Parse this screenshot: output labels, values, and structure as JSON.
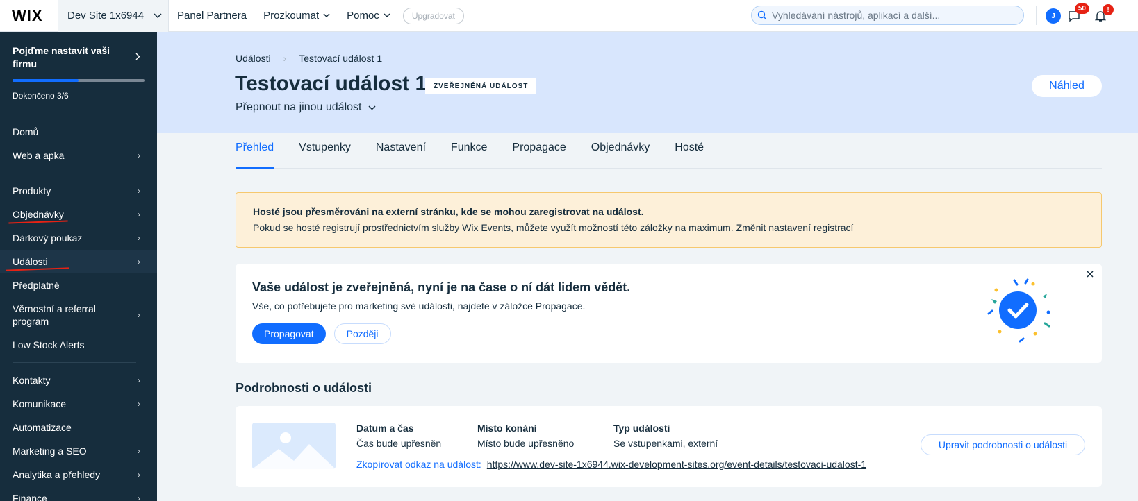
{
  "topbar": {
    "logo": "WIX",
    "site_name": "Dev Site 1x6944",
    "nav": [
      {
        "label": "Panel Partnera",
        "has_dropdown": false
      },
      {
        "label": "Prozkoumat",
        "has_dropdown": true
      },
      {
        "label": "Pomoc",
        "has_dropdown": true
      }
    ],
    "upgrade_label": "Upgradovat",
    "search_placeholder": "Vyhledávání nástrojů, aplikací a další...",
    "avatar_initial": "J",
    "messages_badge": "50",
    "notifications_badge": "!"
  },
  "sidebar": {
    "setup_title": "Pojďme nastavit vaši firmu",
    "setup_progress": 0.5,
    "setup_done": "Dokončeno 3/6",
    "items": [
      {
        "label": "Domů",
        "chevron": false
      },
      {
        "label": "Web a apka",
        "chevron": true
      },
      {
        "label": "Produkty",
        "chevron": true
      },
      {
        "label": "Objednávky",
        "chevron": true
      },
      {
        "label": "Dárkový poukaz",
        "chevron": true
      },
      {
        "label": "Události",
        "chevron": true
      },
      {
        "label": "Předplatné",
        "chevron": false
      },
      {
        "label": "Věrnostní a referral program",
        "chevron": true
      },
      {
        "label": "Low Stock Alerts",
        "chevron": false
      },
      {
        "label": "Kontakty",
        "chevron": true
      },
      {
        "label": "Komunikace",
        "chevron": true
      },
      {
        "label": "Automatizace",
        "chevron": false
      },
      {
        "label": "Marketing a SEO",
        "chevron": true
      },
      {
        "label": "Analytika a přehledy",
        "chevron": true
      },
      {
        "label": "Finance",
        "chevron": true
      }
    ]
  },
  "header": {
    "breadcrumb": [
      "Události",
      "Testovací událost 1"
    ],
    "title": "Testovací událost 1",
    "status_badge": "ZVEŘEJNĚNÁ UDÁLOST",
    "switch_event": "Přepnout na jinou událost",
    "preview_label": "Náhled"
  },
  "tabs": [
    "Přehled",
    "Vstupenky",
    "Nastavení",
    "Funkce",
    "Propagace",
    "Objednávky",
    "Hosté"
  ],
  "notice": {
    "title": "Hosté jsou přesměrováni na externí stránku, kde se mohou zaregistrovat na událost.",
    "text": "Pokud se hosté registrují prostřednictvím služby Wix Events, můžete využít možností této záložky na maximum.",
    "link": "Změnit nastavení registrací"
  },
  "promo": {
    "title": "Vaše událost je zveřejněná, nyní je na čase o ní dát lidem vědět.",
    "text": "Vše, co potřebujete pro marketing své události, najdete v záložce Propagace.",
    "primary": "Propagovat",
    "secondary": "Později"
  },
  "details": {
    "section_title": "Podrobnosti o události",
    "date_label": "Datum a čas",
    "date_value": "Čas bude upřesněn",
    "place_label": "Místo konání",
    "place_value": "Místo bude upřesněno",
    "type_label": "Typ události",
    "type_value": "Se vstupenkami, externí",
    "copy_label": "Zkopírovat odkaz na událost:",
    "url": "https://www.dev-site-1x6944.wix-development-sites.org/event-details/testovaci-udalost-1",
    "edit_label": "Upravit podrobnosti o události"
  },
  "colors": {
    "accent": "#116dff",
    "sidebar_bg": "#162d3d",
    "hero_bg": "#d8e6fd",
    "notice_bg": "#fdf0d9",
    "badge_red": "#e62214"
  }
}
